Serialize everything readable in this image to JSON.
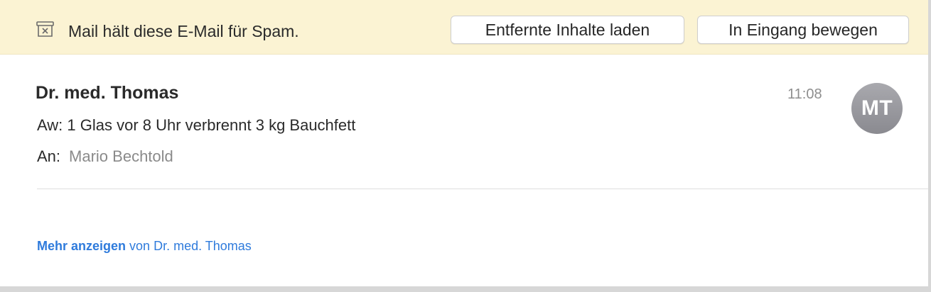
{
  "banner": {
    "icon": "junk-box-icon",
    "message": "Mail hält diese E-Mail für Spam.",
    "load_remote_button": "Entfernte Inhalte laden",
    "move_to_inbox_button": "In Eingang bewegen"
  },
  "message": {
    "sender": "Dr. med. Thomas",
    "time": "11:08",
    "avatar_initials": "MT",
    "subject": "Aw: 1 Glas vor 8 Uhr verbrennt 3 kg Bauchfett",
    "to_label": "An:",
    "to_name": "Mario Bechtold",
    "more_link": "Mehr anzeigen",
    "more_suffix": "von Dr. med. Thomas"
  },
  "colors": {
    "banner_bg": "#fbf3d3",
    "link": "#2f7bdc",
    "avatar": "#9b9ba0"
  }
}
